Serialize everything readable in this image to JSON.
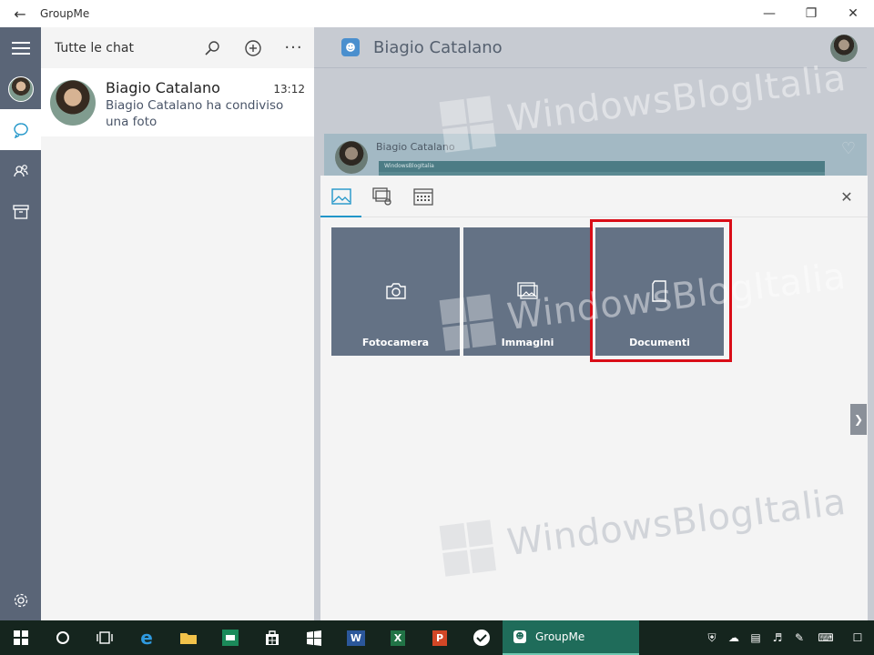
{
  "window": {
    "title": "GroupMe"
  },
  "chatlist": {
    "title": "Tutte le chat",
    "items": [
      {
        "name": "Biagio Catalano",
        "time": "13:12",
        "preview": "Biagio Catalano ha condiviso una foto"
      }
    ]
  },
  "conversation": {
    "name": "Biagio Catalano",
    "message_author": "Biagio Catalano",
    "embedded_title": "WindowsBlogItalia"
  },
  "attach": {
    "tiles": [
      {
        "label": "Fotocamera",
        "icon": "camera-icon"
      },
      {
        "label": "Immagini",
        "icon": "images-icon"
      },
      {
        "label": "Documenti",
        "icon": "document-icon"
      }
    ]
  },
  "watermark": {
    "text": "WindowsBlogItalia"
  },
  "taskbar": {
    "active_app": "GroupMe"
  },
  "colors": {
    "rail": "#5a6577",
    "accent": "#2196c9",
    "tile": "#647285",
    "highlight": "#d90d17",
    "taskbar": "#15251e"
  }
}
